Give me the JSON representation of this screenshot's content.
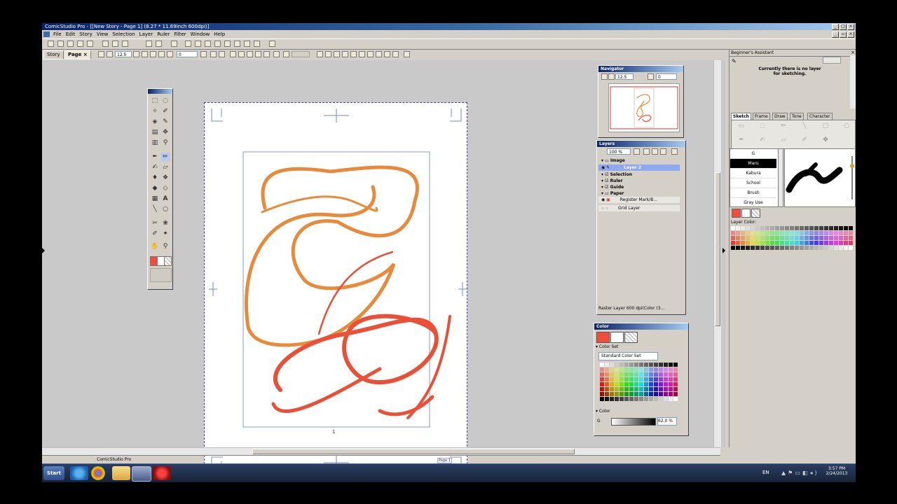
{
  "app": {
    "window_title": "ComicStudio Pro - [[New Story - Page 1] (8.27 * 11.69inch 600dpi)]",
    "menu": [
      "File",
      "Edit",
      "Story",
      "View",
      "Selection",
      "Layer",
      "Ruler",
      "Filter",
      "Window",
      "Help"
    ],
    "tabs": [
      {
        "label": "Story"
      },
      {
        "label": "Page",
        "active": true
      }
    ],
    "zoom_value": "12.5",
    "rotation_value": "0",
    "status_app_name": "ComicStudio Pro"
  },
  "page": {
    "page_number": "1",
    "page_tag": "Page 1"
  },
  "navigator": {
    "title": "Navigator",
    "zoom": "12.5",
    "rotation": "0"
  },
  "layers": {
    "title": "Layers",
    "opacity": "100 %",
    "items": [
      {
        "label": "Image",
        "type": "folder"
      },
      {
        "label": "Layer 2",
        "type": "layer",
        "selected": true
      },
      {
        "label": "Selection",
        "type": "folder"
      },
      {
        "label": "Ruler",
        "type": "folder"
      },
      {
        "label": "Guide",
        "type": "folder"
      },
      {
        "label": "Paper",
        "type": "folder"
      },
      {
        "label": "Register Mark/B...",
        "type": "layer"
      },
      {
        "label": "Grid Layer",
        "type": "layer"
      }
    ],
    "status": "Raster Layer 600 dpi(Color (3..."
  },
  "color_palette": {
    "title": "Color",
    "color_set_header": "Color Set",
    "color_set_name": "Standard Color Set",
    "color_header": "Color",
    "g_label": "G",
    "g_value": "62.0 %",
    "current_color": "#f04e3a"
  },
  "assistant": {
    "title": "Beginner's Assistant",
    "message_line1": "Currently there is no layer",
    "message_line2": "for sketching.",
    "category_tabs": [
      "Sketch",
      "Frame",
      "Draw",
      "Tone",
      "Character"
    ],
    "brush_list": [
      "G",
      "Maru",
      "Kabura",
      "School",
      "Brush",
      "Gray Use"
    ],
    "selected_brush": "Maru",
    "layer_color_label": "Layer Color:"
  },
  "taskbar": {
    "start_label": "Start",
    "language": "EN",
    "time": "3:57 PM",
    "date": "2/24/2013"
  },
  "colors": {
    "stroke_orange": "#e88a3c",
    "stroke_red": "#e85038",
    "title_blue": "#0a246a",
    "selected_layer": "#8fa8f0"
  }
}
